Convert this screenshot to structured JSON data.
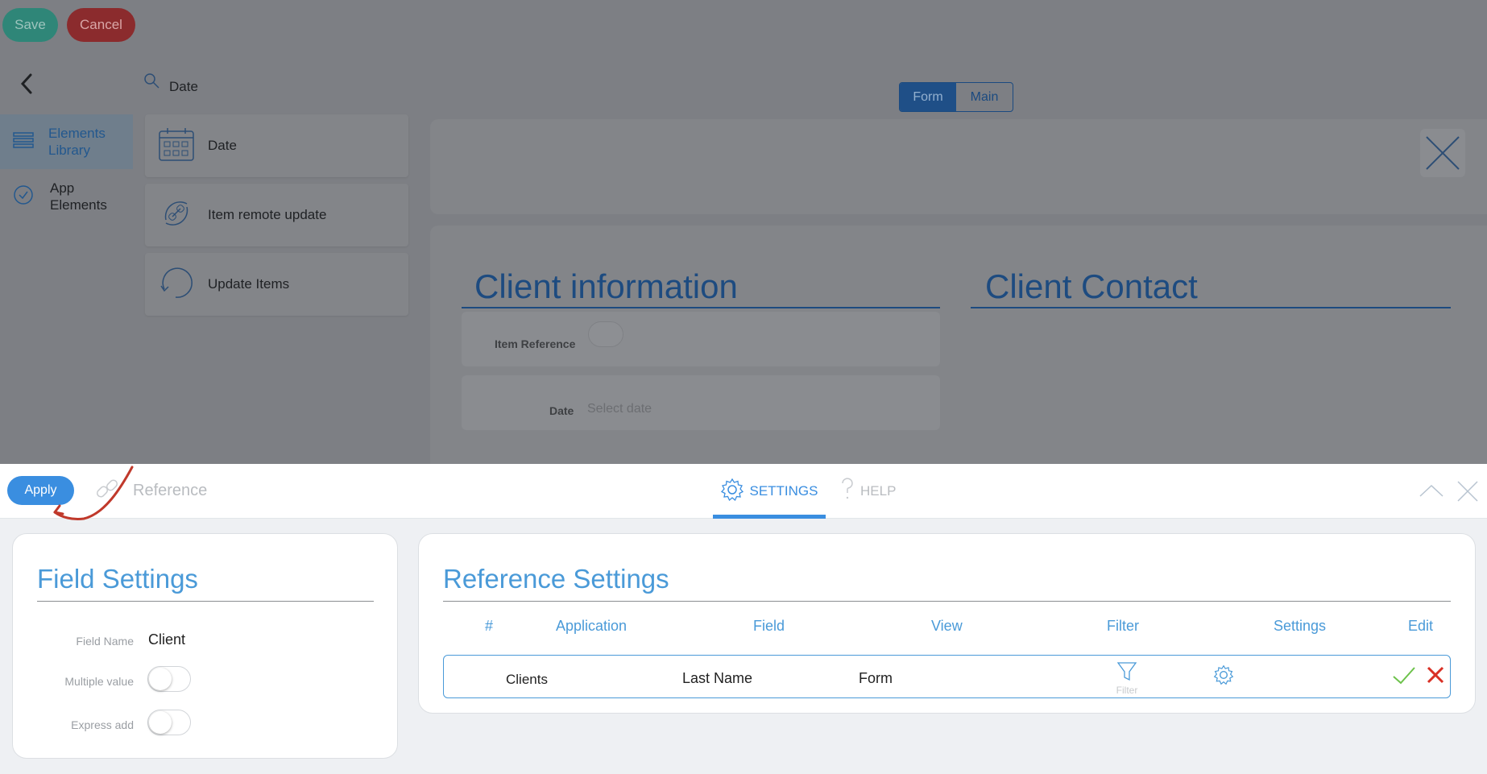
{
  "top": {
    "save_label": "Save",
    "cancel_label": "Cancel",
    "search_value": "Date"
  },
  "sidebar": {
    "items": [
      {
        "label": "Elements Library",
        "icon": "list-icon",
        "active": true
      },
      {
        "label": "App Elements",
        "icon": "check-circle-icon",
        "active": false
      }
    ]
  },
  "library": {
    "items": [
      {
        "label": "Date",
        "icon": "calendar-icon"
      },
      {
        "label": "Item remote update",
        "icon": "link-refresh-icon"
      },
      {
        "label": "Update Items",
        "icon": "refresh-icon"
      }
    ]
  },
  "view_toggle": {
    "options": [
      "Form",
      "Main"
    ],
    "selected": "Form"
  },
  "form_canvas": {
    "section_left_title": "Client information",
    "section_right_title": "Client Contact",
    "rows": [
      {
        "label": "Item Reference",
        "value": ""
      },
      {
        "label": "Date",
        "placeholder": "Select date"
      }
    ]
  },
  "toolbar": {
    "apply_label": "Apply",
    "element_type": "Reference",
    "tabs": [
      {
        "label": "SETTINGS",
        "icon": "gear-icon",
        "active": true
      },
      {
        "label": "HELP",
        "icon": "question-icon",
        "active": false
      }
    ]
  },
  "field_settings": {
    "title": "Field Settings",
    "field_name_label": "Field Name",
    "field_name_value": "Client",
    "multiple_value_label": "Multiple value",
    "multiple_value": false,
    "express_add_label": "Express add",
    "express_add": false
  },
  "reference_settings": {
    "title": "Reference Settings",
    "columns": [
      "#",
      "Application",
      "Field",
      "View",
      "Filter",
      "Settings",
      "Edit"
    ],
    "rows": [
      {
        "application": "Clients",
        "field": "Last Name",
        "view": "Form",
        "filter_label": "Filter"
      }
    ]
  },
  "colors": {
    "accent": "#3a8ee0",
    "save": "#2f8678",
    "cancel": "#8b2b2d",
    "confirm": "#6cc24a",
    "delete": "#d93025",
    "annotation": "#c0392b"
  }
}
